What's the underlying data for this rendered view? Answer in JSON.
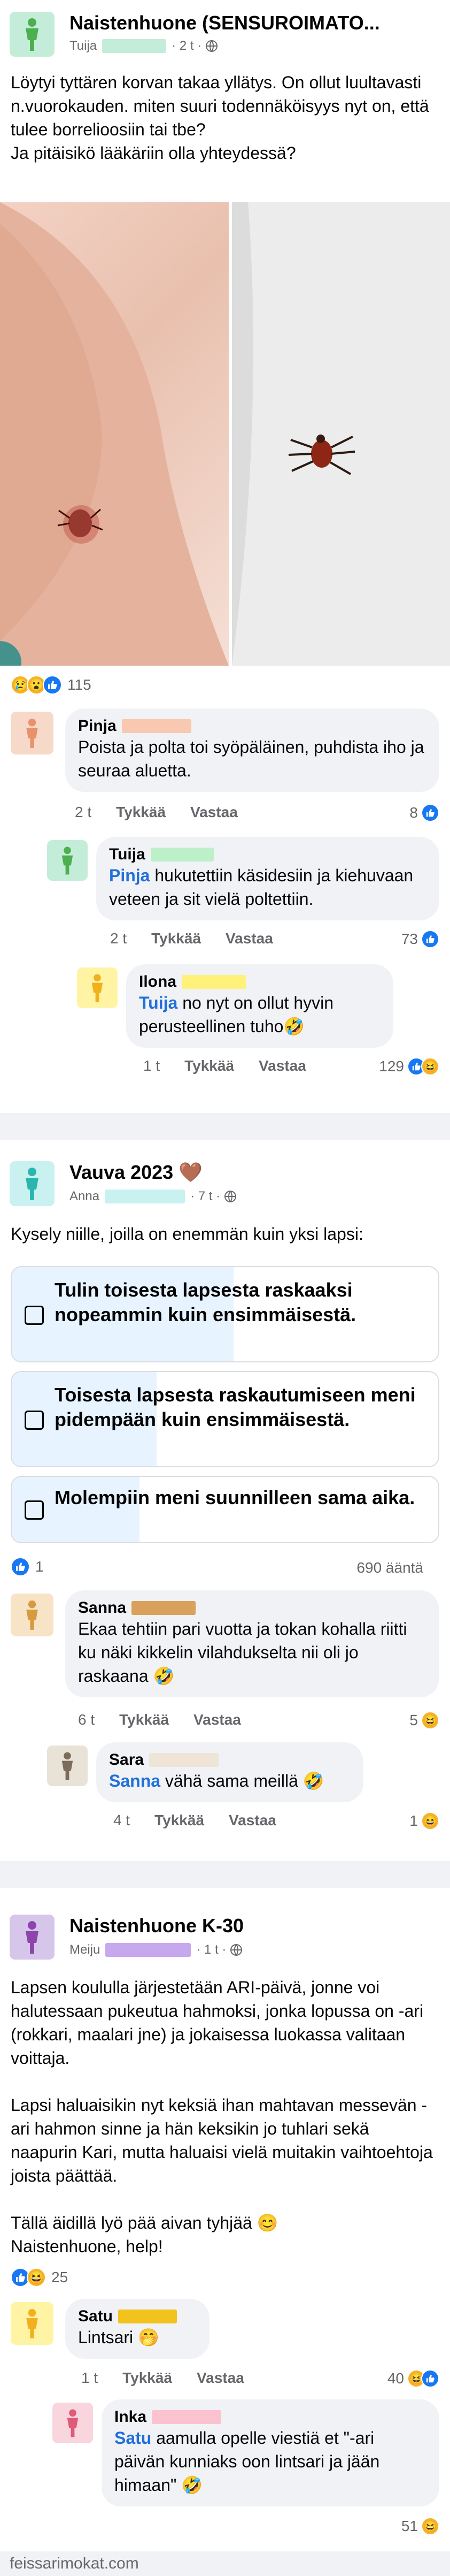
{
  "post1": {
    "group": "Naistenhuone (SENSUROIMATO...",
    "author": "Tuija",
    "time": "2 t",
    "audience_icon": "globe-icon",
    "text_lines": [
      "Löytyi tyttären korvan takaa yllätys. On ollut luultavasti n.vuorokauden. miten suuri todennäköisyys nyt on, että tulee borrelioosiin tai tbe?",
      "Ja pitäisikö lääkäriin olla yhteydessä?"
    ],
    "reaction_count": "115",
    "comments": [
      {
        "name": "Pinja",
        "text": "Poista ja polta toi syöpäläinen, puhdista iho ja seuraa aluetta.",
        "time": "2 t",
        "like": "Tykkää",
        "reply": "Vastaa",
        "count": "8"
      },
      {
        "name": "Tuija",
        "mention": "Pinja",
        "text": " hukutettiin käsidesiin ja kiehuvaan veteen ja sit vielä poltettiin.",
        "time": "2 t",
        "like": "Tykkää",
        "reply": "Vastaa",
        "count": "73"
      },
      {
        "name": "Ilona",
        "mention": "Tuija",
        "text": " no nyt on ollut hyvin perusteellinen tuho",
        "emoji": "🤣",
        "time": "1 t",
        "like": "Tykkää",
        "reply": "Vastaa",
        "count": "129"
      }
    ]
  },
  "post2": {
    "group": "Vauva 2023",
    "group_emoji": "🤎",
    "author": "Anna",
    "time": "7 t",
    "text": "Kysely niille, joilla on enemmän kuin yksi lapsi:",
    "poll": [
      {
        "label": "Tulin toisesta lapsesta raskaaksi nopeammin kuin ensimmäisestä.",
        "fill": 0.52
      },
      {
        "label": "Toisesta lapsesta raskautumiseen meni pidempään kuin ensimmäisestä.",
        "fill": 0.34
      },
      {
        "label": "Molempiin meni suunnilleen sama aika.",
        "fill": 0.3
      }
    ],
    "like_count": "1",
    "votes": "690 ääntä",
    "comments": [
      {
        "name": "Sanna",
        "text": "Ekaa tehtiin pari vuotta ja tokan kohalla riitti ku näki kikkelin vilahdukselta nii oli jo raskaana",
        "emoji": "🤣",
        "time": "6 t",
        "like": "Tykkää",
        "reply": "Vastaa",
        "count": "5"
      },
      {
        "name": "Sara",
        "mention": "Sanna",
        "text": " vähä sama meillä",
        "emoji": "🤣",
        "time": "4 t",
        "like": "Tykkää",
        "reply": "Vastaa",
        "count": "1"
      }
    ]
  },
  "post3": {
    "group": "Naistenhuone K-30",
    "author": "Meiju",
    "time": "1 t",
    "paragraphs": [
      "Lapsen koululla järjestetään ARI-päivä, jonne voi halutessaan pukeutua hahmoksi, jonka lopussa on -ari (rokkari, maalari jne) ja jokaisessa luokassa valitaan voittaja.",
      "Lapsi haluaisikin nyt keksiä ihan mahtavan messevän -ari hahmon sinne ja hän keksikin jo tuhlari sekä naapurin Kari, mutta haluaisi vielä muitakin vaihtoehtoja joista päättää.",
      "Tällä äidillä lyö pää aivan tyhjää 😊\nNaistenhuone, help!"
    ],
    "reaction_count": "25",
    "comments": [
      {
        "name": "Satu",
        "text": "Lintsari",
        "emoji": "🤭",
        "time": "1 t",
        "like": "Tykkää",
        "reply": "Vastaa",
        "count": "40"
      },
      {
        "name": "Inka",
        "mention": "Satu",
        "text": " aamulla opelle viestiä et \"-ari päivän kunniaks oon lintsari ja jään himaan\"",
        "emoji": "🤣",
        "time": "1 t",
        "like": "Tykkää",
        "reply": "Vastaa",
        "count": "51"
      }
    ]
  },
  "footer": "feissarimokat.com",
  "colors": {
    "mint": "#c4edd9",
    "peach": "#f7d9c9",
    "yellow": "#fff4a3",
    "lilac": "#d5c6ea",
    "pink": "#f9d5de",
    "beige": "#efe4d6",
    "like_blue": "#1877f2",
    "mention": "#216fdb"
  }
}
